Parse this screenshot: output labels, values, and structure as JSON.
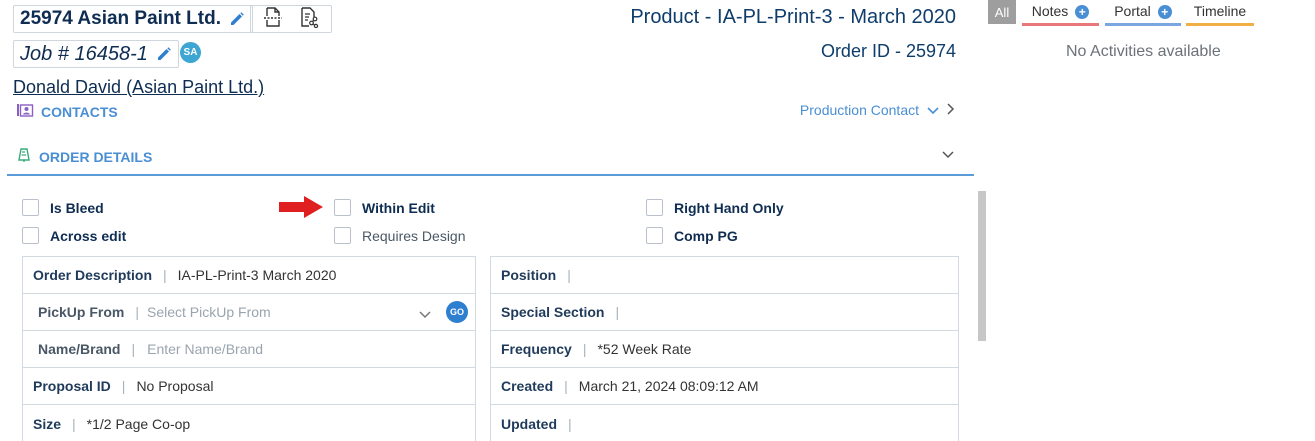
{
  "header": {
    "customer_name": "25974 Asian Paint Ltd.",
    "job_number": "Job # 16458-1",
    "assignee_initials": "SA",
    "contact_name": "Donald David (Asian Paint Ltd.)",
    "product_title": "Product - IA-PL-Print-3 - March 2020",
    "order_id": "Order ID - 25974"
  },
  "sections": {
    "contacts_label": "CONTACTS",
    "production_contact_label": "Production Contact",
    "order_details_label": "ORDER DETAILS"
  },
  "checkboxes": {
    "is_bleed": "Is Bleed",
    "across_edit": "Across edit",
    "within_edit": "Within Edit",
    "requires_design": "Requires Design",
    "right_hand_only": "Right Hand Only",
    "comp_pg": "Comp PG"
  },
  "left_form": {
    "order_description": {
      "label": "Order Description",
      "value": "IA-PL-Print-3 March 2020"
    },
    "pickup_from": {
      "label": "PickUp From",
      "placeholder": "Select PickUp From",
      "go_label": "GO"
    },
    "name_brand": {
      "label": "Name/Brand",
      "placeholder": "Enter Name/Brand"
    },
    "proposal_id": {
      "label": "Proposal ID",
      "value": "No Proposal"
    },
    "size": {
      "label": "Size",
      "value": "*1/2 Page Co-op"
    }
  },
  "right_form": {
    "position": {
      "label": "Position",
      "value": ""
    },
    "special_section": {
      "label": "Special Section",
      "value": ""
    },
    "frequency": {
      "label": "Frequency",
      "value": "*52 Week Rate"
    },
    "created": {
      "label": "Created",
      "value": "March 21, 2024 08:09:12 AM"
    },
    "updated": {
      "label": "Updated",
      "value": ""
    }
  },
  "activity_panel": {
    "tabs": [
      {
        "label": "All"
      },
      {
        "label": "Notes"
      },
      {
        "label": "Portal"
      },
      {
        "label": "Timeline"
      }
    ],
    "empty_message": "No Activities available"
  },
  "colors": {
    "accent_blue": "#4a8fd4",
    "notes_underline": "#e8777a",
    "portal_underline": "#7aa7df",
    "timeline_underline": "#f0b045",
    "arrow_red": "#e02020"
  },
  "icons": [
    "pencil-icon",
    "document-scan-icon",
    "document-share-icon",
    "contacts-icon",
    "order-details-icon",
    "chevron-down-icon",
    "chevron-right-icon",
    "plus-icon",
    "red-arrow-icon"
  ]
}
